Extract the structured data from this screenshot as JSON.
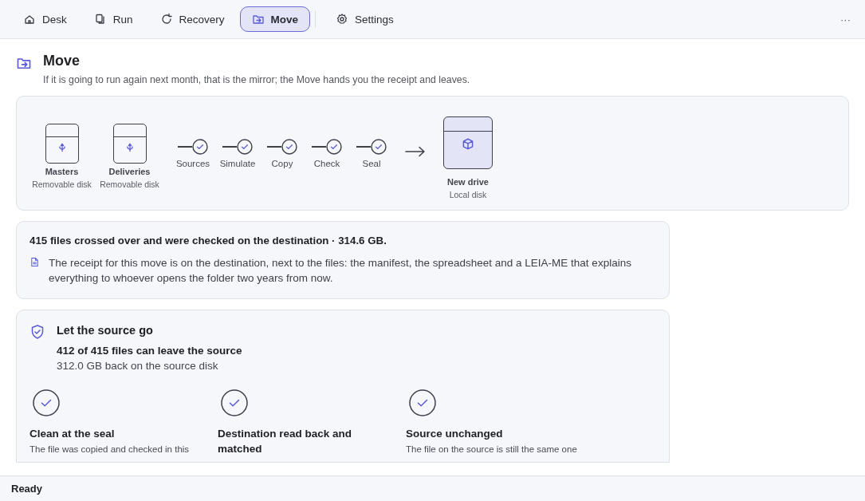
{
  "nav": {
    "tabs": [
      {
        "label": "Desk",
        "kind": "home",
        "selected": false
      },
      {
        "label": "Run",
        "kind": "copy",
        "selected": false
      },
      {
        "label": "Recovery",
        "kind": "refresh",
        "selected": false
      },
      {
        "label": "Move",
        "kind": "folder",
        "selected": true
      },
      {
        "label": "Settings",
        "kind": "gear",
        "selected": false
      }
    ],
    "more": "···"
  },
  "header": {
    "title": "Move",
    "subtitle": "If it is going to run again next month, that is the mirror; the Move hands you the receipt and leaves."
  },
  "flow": {
    "sources": [
      {
        "name": "Masters",
        "type": "Removable disk"
      },
      {
        "name": "Deliveries",
        "type": "Removable disk"
      }
    ],
    "steps": [
      {
        "label": "Sources",
        "done": true
      },
      {
        "label": "Simulate",
        "done": true
      },
      {
        "label": "Copy",
        "done": true
      },
      {
        "label": "Check",
        "done": true
      },
      {
        "label": "Seal",
        "done": true
      }
    ],
    "destination": {
      "name": "New drive",
      "type": "Local disk"
    }
  },
  "summary": {
    "headline": "415 files crossed over and were checked on the destination · 314.6 GB.",
    "note": "The receipt for this move is on the destination, next to the files: the manifest, the spreadsheet and a LEIA-ME that explains everything to whoever opens the folder two years from now."
  },
  "release": {
    "title": "Let the source go",
    "count": "412 of 415 files can leave the source",
    "space": "312.0 GB back on the source disk",
    "checks": [
      {
        "title": "Clean at the seal",
        "text": "The file was copied and checked in this",
        "passed": true
      },
      {
        "title": "Destination read back and matched",
        "passed": true
      },
      {
        "title": "Source unchanged",
        "text": "The file on the source is still the same one",
        "passed": true
      }
    ]
  },
  "status_bar": "Ready"
}
